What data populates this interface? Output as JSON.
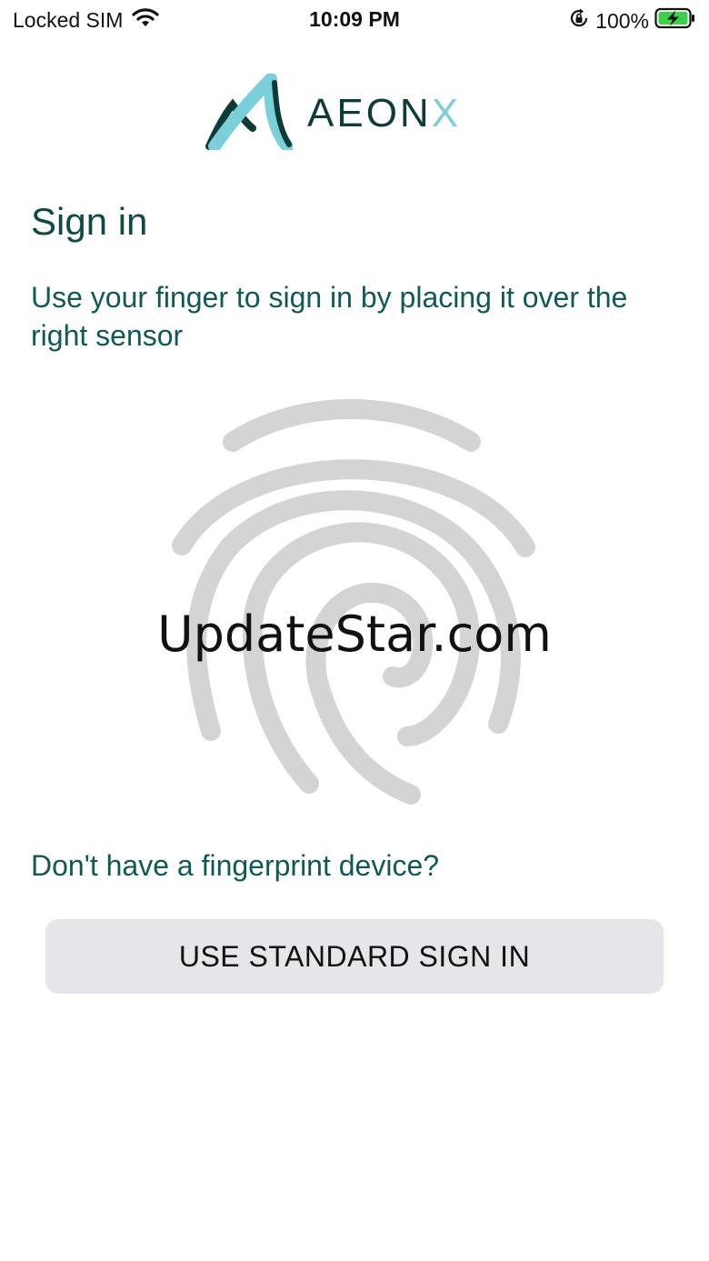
{
  "status_bar": {
    "carrier": "Locked SIM",
    "time": "10:09 PM",
    "battery_percent": "100%",
    "icons": [
      "wifi-icon",
      "orientation-lock-icon",
      "battery-charging-icon"
    ]
  },
  "logo": {
    "text_main": "AEON",
    "text_x": "X",
    "colors": {
      "dark": "#0c3b38",
      "light": "#7ad0d8"
    }
  },
  "sign_in": {
    "title": "Sign in",
    "instruction": "Use your finger to sign in by placing it over the right sensor"
  },
  "fingerprint": {
    "icon": "fingerprint-icon",
    "color": "#d4d4d4"
  },
  "watermark": "UpdateStar.com",
  "alternate": {
    "prompt": "Don't have a fingerprint device?",
    "button_label": "USE STANDARD SIGN IN"
  },
  "colors": {
    "accent_text": "#0f5a56",
    "button_bg": "#e6e6ea"
  }
}
